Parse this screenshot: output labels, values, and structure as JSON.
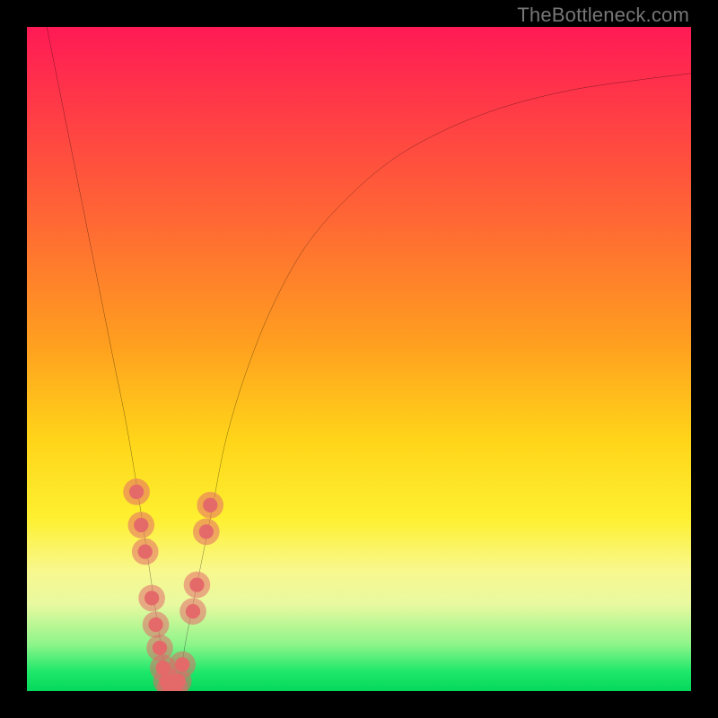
{
  "watermark": "TheBottleneck.com",
  "chart_data": {
    "type": "line",
    "title": "",
    "xlabel": "",
    "ylabel": "",
    "xlim": [
      0,
      100
    ],
    "ylim": [
      0,
      100
    ],
    "background_metric": "bottleneck_severity_gradient",
    "gradient_stops": [
      {
        "pos": 0,
        "color": "#ff1a55"
      },
      {
        "pos": 12,
        "color": "#ff3a47"
      },
      {
        "pos": 30,
        "color": "#ff6a33"
      },
      {
        "pos": 48,
        "color": "#ffa01f"
      },
      {
        "pos": 62,
        "color": "#ffd419"
      },
      {
        "pos": 74,
        "color": "#fef030"
      },
      {
        "pos": 82,
        "color": "#f8f88f"
      },
      {
        "pos": 87,
        "color": "#e8f9a0"
      },
      {
        "pos": 93,
        "color": "#8df58a"
      },
      {
        "pos": 97,
        "color": "#20e86a"
      },
      {
        "pos": 100,
        "color": "#04d85c"
      }
    ],
    "series": [
      {
        "name": "bottleneck-curve",
        "color": "#000000",
        "x": [
          3,
          5,
          7,
          9,
          11,
          13,
          15,
          17,
          18.5,
          20,
          21,
          22,
          23,
          24,
          26,
          28,
          30,
          33,
          37,
          42,
          48,
          55,
          63,
          72,
          82,
          92,
          100
        ],
        "y": [
          100,
          90,
          80,
          70,
          60,
          50,
          40,
          28,
          18,
          8,
          2,
          0,
          2,
          8,
          18,
          28,
          38,
          48,
          58,
          67,
          74,
          80,
          84.5,
          88,
          90.5,
          92,
          93
        ]
      }
    ],
    "markers": {
      "name": "highlighted-points",
      "color": "#e46a6a",
      "radius_outer": 2.0,
      "radius_inner": 1.1,
      "points": [
        {
          "x": 16.5,
          "y": 30
        },
        {
          "x": 17.2,
          "y": 25
        },
        {
          "x": 17.8,
          "y": 21
        },
        {
          "x": 18.8,
          "y": 14
        },
        {
          "x": 19.4,
          "y": 10
        },
        {
          "x": 20.0,
          "y": 6.5
        },
        {
          "x": 20.5,
          "y": 3.5
        },
        {
          "x": 21.0,
          "y": 1.5
        },
        {
          "x": 21.6,
          "y": 0.5
        },
        {
          "x": 22.2,
          "y": 0.5
        },
        {
          "x": 22.8,
          "y": 1.5
        },
        {
          "x": 23.4,
          "y": 4
        },
        {
          "x": 25.0,
          "y": 12
        },
        {
          "x": 25.6,
          "y": 16
        },
        {
          "x": 27.0,
          "y": 24
        },
        {
          "x": 27.6,
          "y": 28
        }
      ]
    }
  }
}
